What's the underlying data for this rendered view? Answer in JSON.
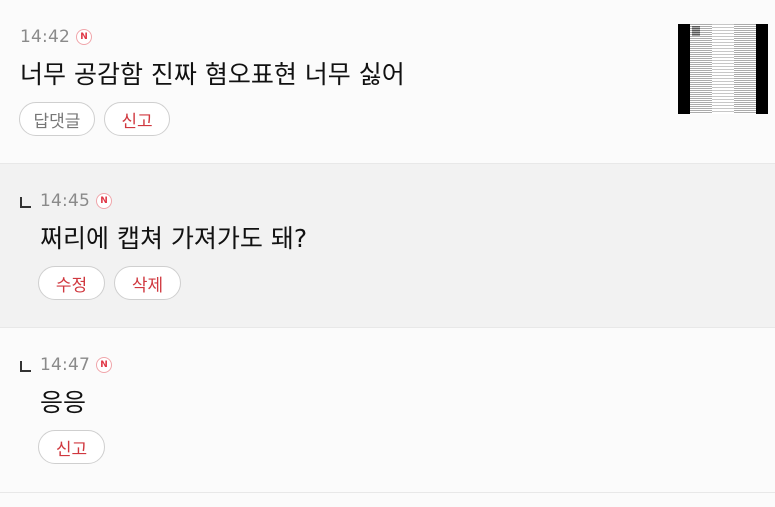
{
  "comments": [
    {
      "time": "14:42",
      "badge": "N",
      "text": "너무 공감함 진짜 혐오표현 너무 싫어",
      "actions": [
        "답댓글",
        "신고"
      ],
      "is_reply": false
    },
    {
      "time": "14:45",
      "badge": "N",
      "text": "쩌리에 캡쳐 가져가도 돼?",
      "actions": [
        "수정",
        "삭제"
      ],
      "is_reply": true
    },
    {
      "time": "14:47",
      "badge": "N",
      "text": "응응",
      "actions": [
        "신고"
      ],
      "is_reply": true
    }
  ],
  "colors": {
    "action_red": "#d0383f",
    "action_gray": "#777777",
    "badge_red": "#e03847",
    "reply_bg": "#f2f2f2"
  },
  "icons": {
    "new_badge": "new-badge-icon",
    "reply_marker": "reply-arrow-icon",
    "attachment": "attachment-thumbnail"
  }
}
